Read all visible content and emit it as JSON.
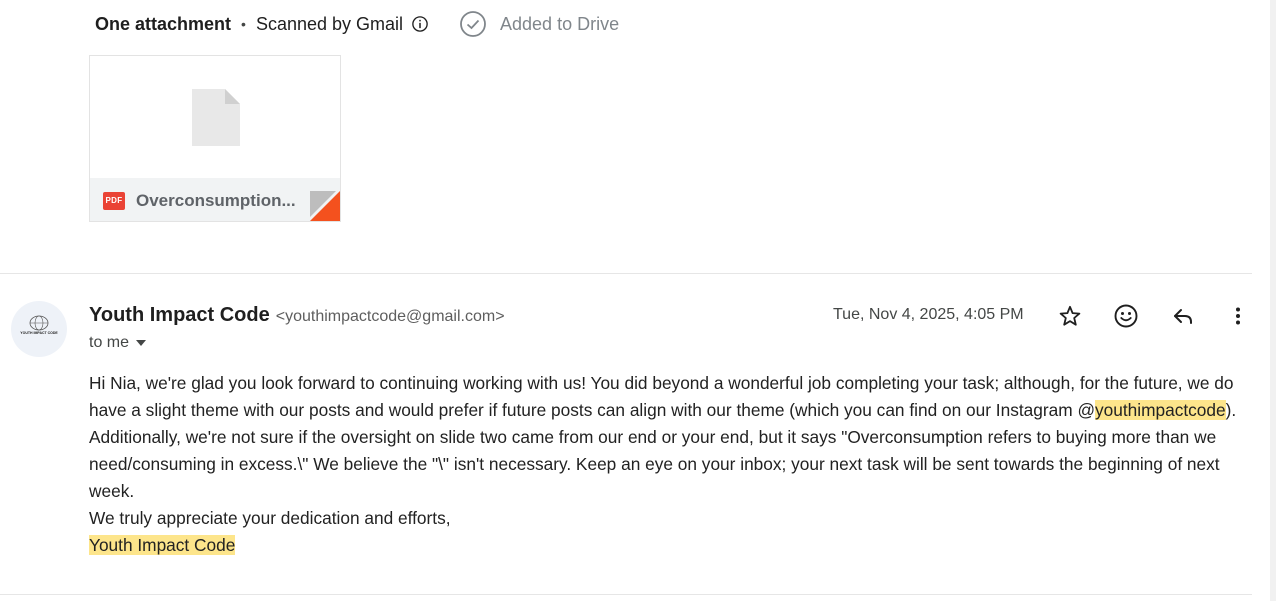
{
  "attachments": {
    "count_label": "One attachment",
    "separator": "•",
    "scanned_label": "Scanned by Gmail",
    "drive_label": "Added to Drive",
    "file": {
      "badge": "PDF",
      "name": "Overconsumption..."
    }
  },
  "message": {
    "sender_name": "Youth Impact Code",
    "sender_email": "<youthimpactcode@gmail.com>",
    "recipient_label": "to me",
    "date": "Tue, Nov 4, 2025, 4:05 PM",
    "avatar_label": "YOUTH IMPACT CODE",
    "body": {
      "p1_a": "Hi Nia, we're glad you look forward to continuing working with us! You did beyond a wonderful job completing your task; although, for the future, we do have a slight theme with our posts and would prefer if future posts can align with our theme (which you can find on our Instagram @",
      "p1_handle": "youthimpactcode",
      "p1_b": "). Additionally, we're not sure if the oversight on slide two came from our end or your end, but it says \"Overconsumption refers to buying more than we need/consuming in excess.\\\" We believe the \"\\\" isn't necessary. Keep an eye on your inbox; your next task will be sent towards the beginning of next week.",
      "closing": "We truly appreciate your dedication and efforts,",
      "signature": "Youth Impact Code"
    }
  },
  "icons": {
    "info": "info-icon",
    "drive_check": "check-circle-icon",
    "file": "file-icon",
    "star": "star-icon",
    "emoji": "emoji-icon",
    "reply": "reply-icon",
    "more": "more-vert-icon",
    "caret": "caret-down-icon"
  },
  "colors": {
    "highlight": "#fde58b",
    "pdf_red": "#ea4335",
    "muted": "#80868b"
  }
}
